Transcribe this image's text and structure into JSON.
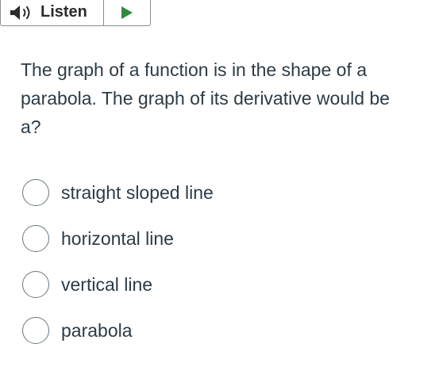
{
  "listen": {
    "label": "Listen"
  },
  "question": {
    "lines": [
      "The graph of a function is in the shape of a",
      "parabola.  The graph of its derivative would be",
      "a?"
    ]
  },
  "options": [
    {
      "label": "straight sloped line",
      "selected": false
    },
    {
      "label": "horizontal line",
      "selected": false
    },
    {
      "label": "vertical line",
      "selected": false
    },
    {
      "label": "parabola",
      "selected": false
    }
  ],
  "colors": {
    "text": "#2d3b45",
    "play_icon": "#2f8a3e",
    "border": "#8b8b8b"
  },
  "icons": {
    "speaker": "speaker-icon",
    "play": "play-icon"
  }
}
